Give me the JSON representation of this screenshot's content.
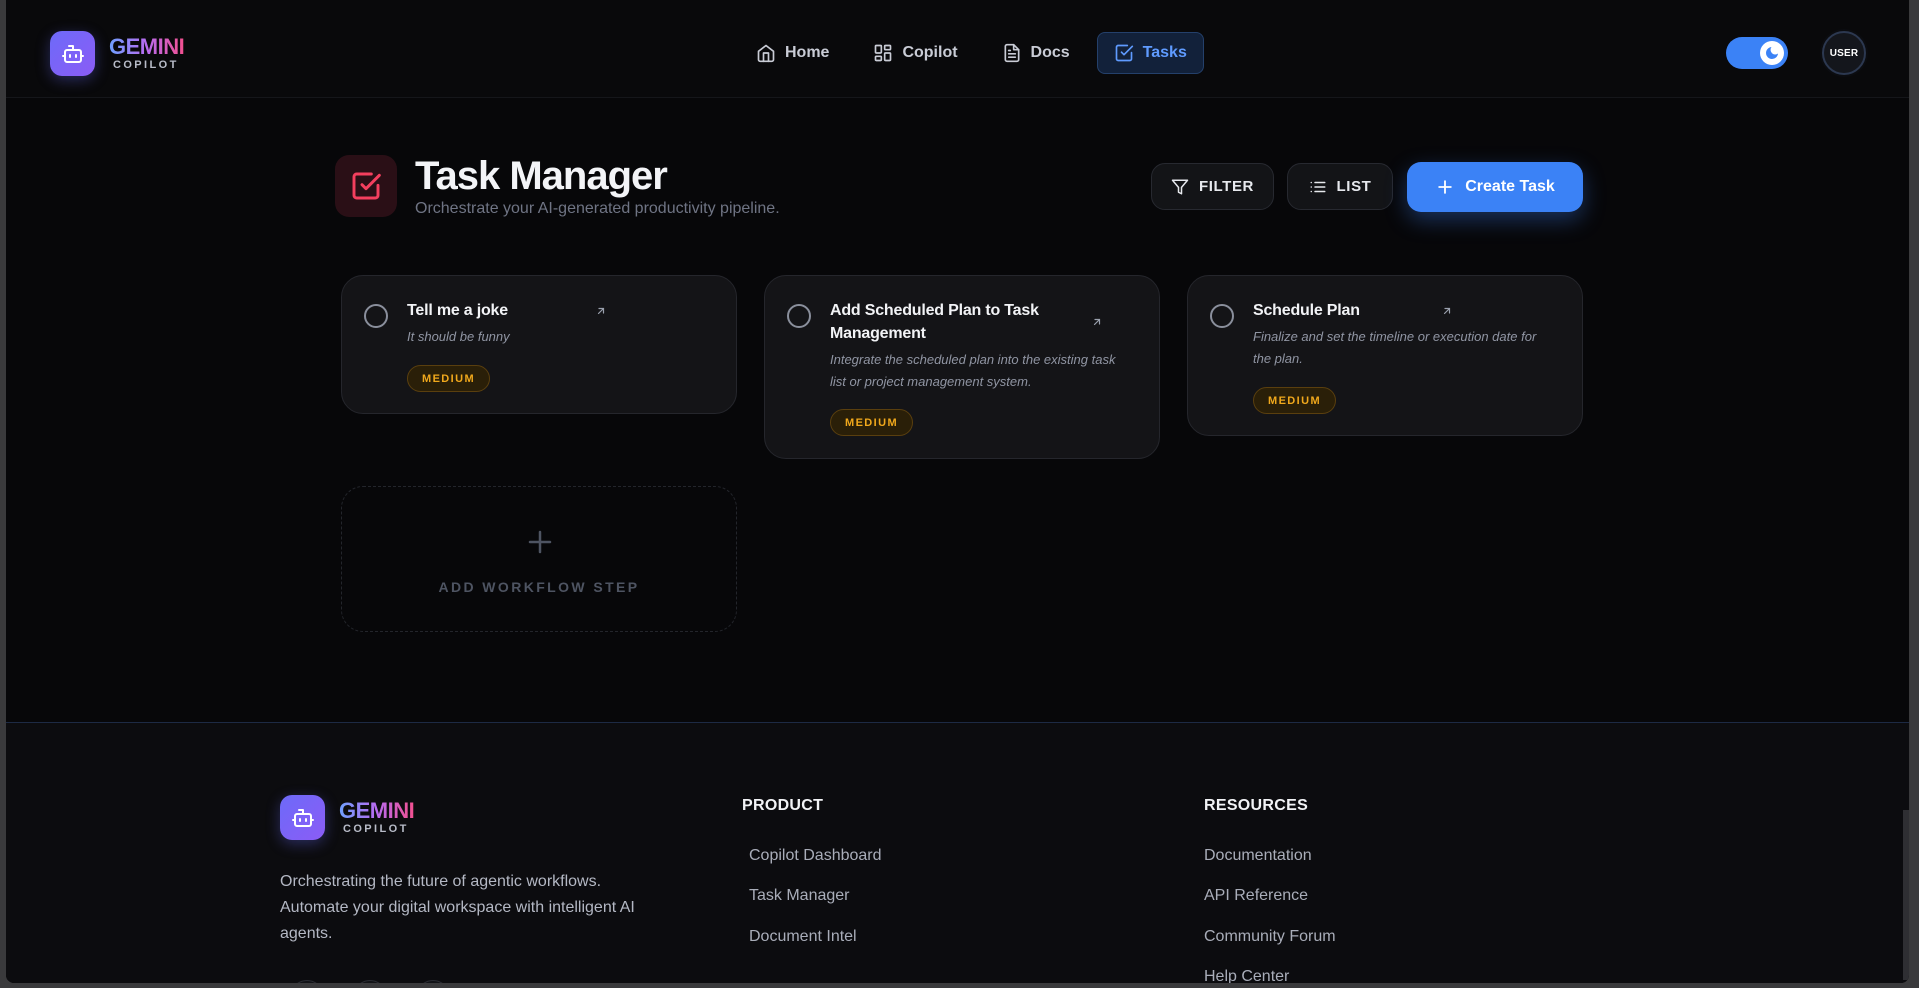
{
  "brand": {
    "name": "GEMINI",
    "sub": "COPILOT"
  },
  "nav": [
    {
      "label": "Home",
      "icon": "home-icon"
    },
    {
      "label": "Copilot",
      "icon": "grid-icon"
    },
    {
      "label": "Docs",
      "icon": "document-icon"
    },
    {
      "label": "Tasks",
      "icon": "checkbox-icon",
      "active": true
    }
  ],
  "user": {
    "avatar_label": "USER"
  },
  "header": {
    "title": "Task Manager",
    "subtitle": "Orchestrate your AI-generated productivity pipeline.",
    "filter_label": "FILTER",
    "list_label": "LIST",
    "create_label": "Create Task"
  },
  "tasks": [
    {
      "title": "Tell me a joke",
      "description": "It should be funny",
      "priority": "MEDIUM"
    },
    {
      "title": "Add Scheduled Plan to Task Management",
      "description": "Integrate the scheduled plan into the existing task list or project management system.",
      "priority": "MEDIUM"
    },
    {
      "title": "Schedule Plan",
      "description": "Finalize and set the timeline or execution date for the plan.",
      "priority": "MEDIUM"
    }
  ],
  "add_step": {
    "label": "ADD WORKFLOW STEP"
  },
  "footer": {
    "brand": {
      "name": "GEMINI",
      "sub": "COPILOT"
    },
    "tagline": "Orchestrating the future of agentic workflows. Automate your digital workspace with intelligent AI agents.",
    "product": {
      "title": "PRODUCT",
      "links": [
        "Copilot Dashboard",
        "Task Manager",
        "Document Intel"
      ]
    },
    "resources": {
      "title": "RESOURCES",
      "links": [
        "Documentation",
        "API Reference",
        "Community Forum",
        "Help Center"
      ]
    }
  },
  "colors": {
    "accent": "#3b82f6",
    "background": "#070709",
    "card": "#141417",
    "priority_medium": "#f0a81c",
    "task_icon": "#f43f5e"
  }
}
